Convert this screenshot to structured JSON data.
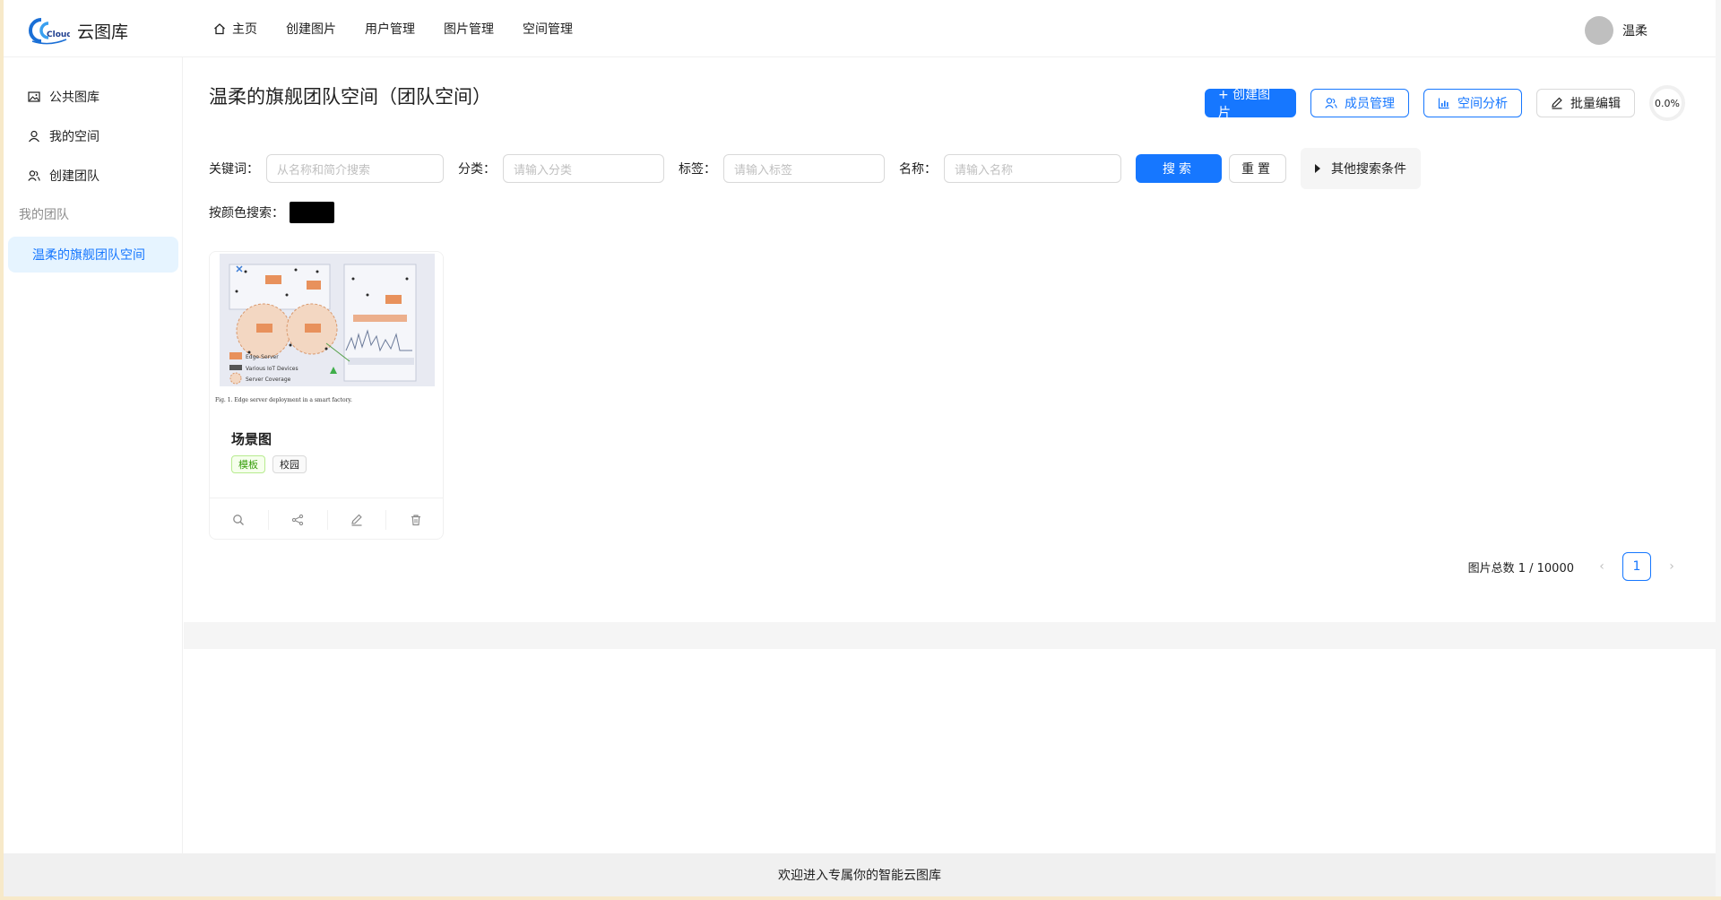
{
  "app": {
    "name": "云图库",
    "logo_text": "Cloud"
  },
  "nav": {
    "items": [
      {
        "label": "主页",
        "icon": "home-icon"
      },
      {
        "label": "创建图片"
      },
      {
        "label": "用户管理"
      },
      {
        "label": "图片管理"
      },
      {
        "label": "空间管理"
      }
    ]
  },
  "user": {
    "name": "温柔"
  },
  "sidebar": {
    "items": [
      {
        "label": "公共图库",
        "icon": "picture-icon"
      },
      {
        "label": "我的空间",
        "icon": "user-icon"
      },
      {
        "label": "创建团队",
        "icon": "team-icon"
      }
    ],
    "group_label": "我的团队",
    "team_item": "温柔的旗舰团队空间"
  },
  "main": {
    "title": "温柔的旗舰团队空间（团队空间）",
    "actions": {
      "create_picture": "+ 创建图片",
      "member_manage": "成员管理",
      "space_analysis": "空间分析",
      "batch_edit": "批量编辑",
      "usage_percent": "0.0%"
    },
    "search": {
      "keyword_label": "关键词：",
      "keyword_placeholder": "从名称和简介搜索",
      "category_label": "分类：",
      "category_placeholder": "请输入分类",
      "tag_label": "标签：",
      "tag_placeholder": "请输入标签",
      "name_label": "名称：",
      "name_placeholder": "请输入名称",
      "search_button": "搜索",
      "reset_button": "重置",
      "more_conditions": "其他搜索条件"
    },
    "color_search": {
      "label": "按颜色搜索：",
      "color": "#000000"
    },
    "card": {
      "title": "场景图",
      "tags": [
        "模板",
        "校园"
      ],
      "cover": {
        "legend": [
          "Edge Server",
          "Various IoT Devices",
          "Server Coverage"
        ],
        "caption": "Fig. 1.    Edge server deployment in a smart factory."
      }
    },
    "pagination": {
      "total_text": "图片总数 1 / 10000",
      "current_page": "1",
      "prev": "‹",
      "next": "›"
    }
  },
  "footer": {
    "text": "欢迎进入专属你的智能云图库"
  }
}
